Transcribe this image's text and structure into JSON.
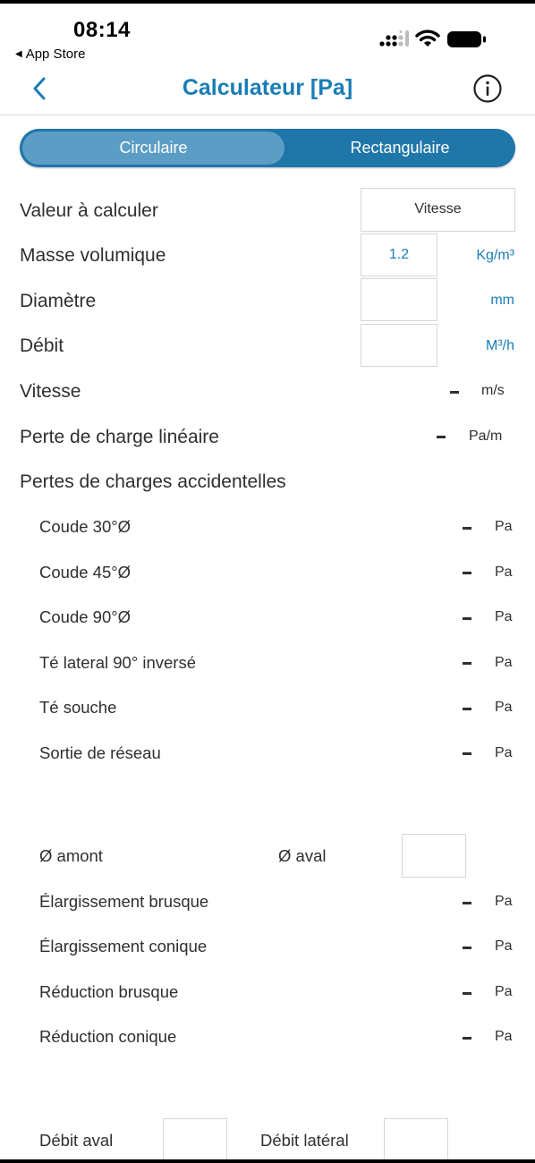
{
  "status_bar": {
    "time": "08:14",
    "back_app": "App Store"
  },
  "nav": {
    "title": "Calculateur [Pa]"
  },
  "segment": {
    "active": "Circulaire",
    "inactive": "Rectangulaire"
  },
  "inputs": {
    "valeur_label": "Valeur à calculer",
    "valeur_value": "Vitesse",
    "masse_label": "Masse volumique",
    "masse_value": "1.2",
    "masse_unit": "Kg/m³",
    "diametre_label": "Diamètre",
    "diametre_value": "",
    "diametre_unit": "mm",
    "debit_label": "Débit",
    "debit_value": "",
    "debit_unit": "M³/h"
  },
  "results": {
    "vitesse_label": "Vitesse",
    "vitesse_value": "-",
    "vitesse_unit": "m/s",
    "perte_label": "Perte de charge linéaire",
    "perte_value": "-",
    "perte_unit": "Pa/m"
  },
  "accidentelles": {
    "title": "Pertes de charges accidentelles",
    "unit": "Pa",
    "items": [
      {
        "label": "Coude 30°Ø",
        "value": "-"
      },
      {
        "label": "Coude 45°Ø",
        "value": "-"
      },
      {
        "label": "Coude 90°Ø",
        "value": "-"
      },
      {
        "label": "Té lateral 90° inversé",
        "value": "-"
      },
      {
        "label": "Té souche",
        "value": "-"
      },
      {
        "label": "Sortie de réseau",
        "value": "-"
      }
    ]
  },
  "diametres": {
    "amont_label": "Ø amont",
    "aval_label": "Ø aval",
    "aval_value": "",
    "items": [
      {
        "label": "Élargissement brusque",
        "value": "-"
      },
      {
        "label": "Élargissement conique",
        "value": "-"
      },
      {
        "label": "Réduction brusque",
        "value": "-"
      },
      {
        "label": "Réduction conique",
        "value": "-"
      }
    ]
  },
  "debits": {
    "aval_label": "Débit aval",
    "aval_value": "",
    "lateral_label": "Débit latéral",
    "lateral_value": ""
  },
  "icons": [
    "chevron-left-icon",
    "info-icon",
    "signal-icon",
    "wifi-icon",
    "battery-icon"
  ],
  "colors": {
    "accent": "#1a7db5",
    "segment_bg": "#1f76a8",
    "segment_active": "#5b9dc4"
  }
}
